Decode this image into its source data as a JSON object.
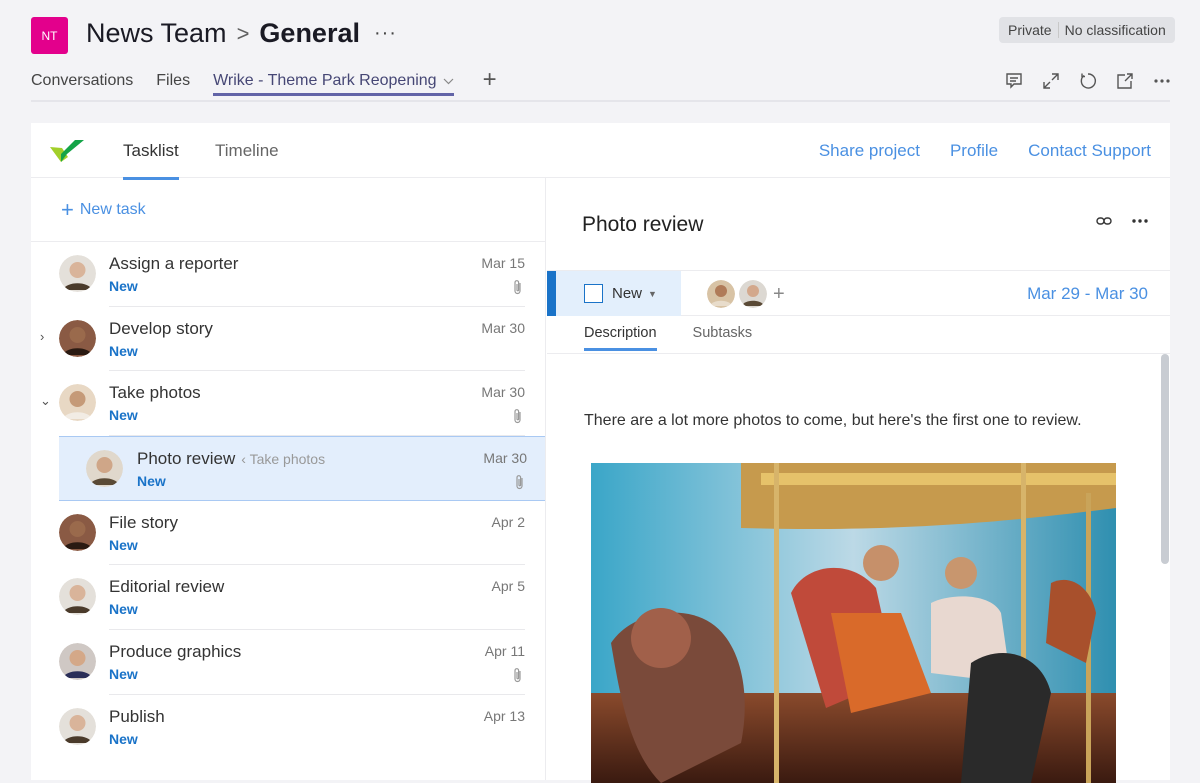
{
  "team": {
    "initials": "NT",
    "name": "News Team",
    "channel": "General",
    "color": "#e3008c"
  },
  "badge": {
    "privacy": "Private",
    "classification": "No classification"
  },
  "tabs": [
    {
      "label": "Conversations"
    },
    {
      "label": "Files"
    },
    {
      "label": "Wrike - Theme Park Reopening",
      "active": true
    }
  ],
  "toolbar": {
    "icons": [
      "chat-icon",
      "expand-icon",
      "refresh-icon",
      "popout-icon",
      "more-icon"
    ]
  },
  "wrike": {
    "tabs": [
      {
        "label": "Tasklist",
        "active": true
      },
      {
        "label": "Timeline"
      }
    ],
    "links": [
      "Share project",
      "Profile",
      "Contact Support"
    ],
    "new_task": "New task"
  },
  "tasks": [
    {
      "name": "Assign a reporter",
      "status": "New",
      "date": "Mar 15",
      "attachment": true,
      "avatar": "man-bald"
    },
    {
      "name": "Develop story",
      "status": "New",
      "date": "Mar 30",
      "attachment": false,
      "expand": "collapsed",
      "avatar": "woman-curly"
    },
    {
      "name": "Take photos",
      "status": "New",
      "date": "Mar 30",
      "attachment": true,
      "expand": "expanded",
      "avatar": "man-beard"
    },
    {
      "name": "Photo review",
      "parent": "Take photos",
      "status": "New",
      "date": "Mar 30",
      "attachment": true,
      "selected": true,
      "avatar": "split"
    },
    {
      "name": "File story",
      "status": "New",
      "date": "Apr 2",
      "attachment": false,
      "avatar": "woman-curly"
    },
    {
      "name": "Editorial review",
      "status": "New",
      "date": "Apr 5",
      "attachment": false,
      "avatar": "man-bald"
    },
    {
      "name": "Produce graphics",
      "status": "New",
      "date": "Apr 11",
      "attachment": true,
      "avatar": "woman-hat"
    },
    {
      "name": "Publish",
      "status": "New",
      "date": "Apr 13",
      "attachment": false,
      "avatar": "man-bald"
    }
  ],
  "detail": {
    "title": "Photo review",
    "status": "New",
    "date_range": "Mar 29 - Mar 30",
    "tabs": [
      {
        "label": "Description",
        "active": true
      },
      {
        "label": "Subtasks"
      }
    ],
    "description": "There are a lot more photos to come, but here's the first one to review.",
    "image_alt": "Couple riding a carousel"
  }
}
